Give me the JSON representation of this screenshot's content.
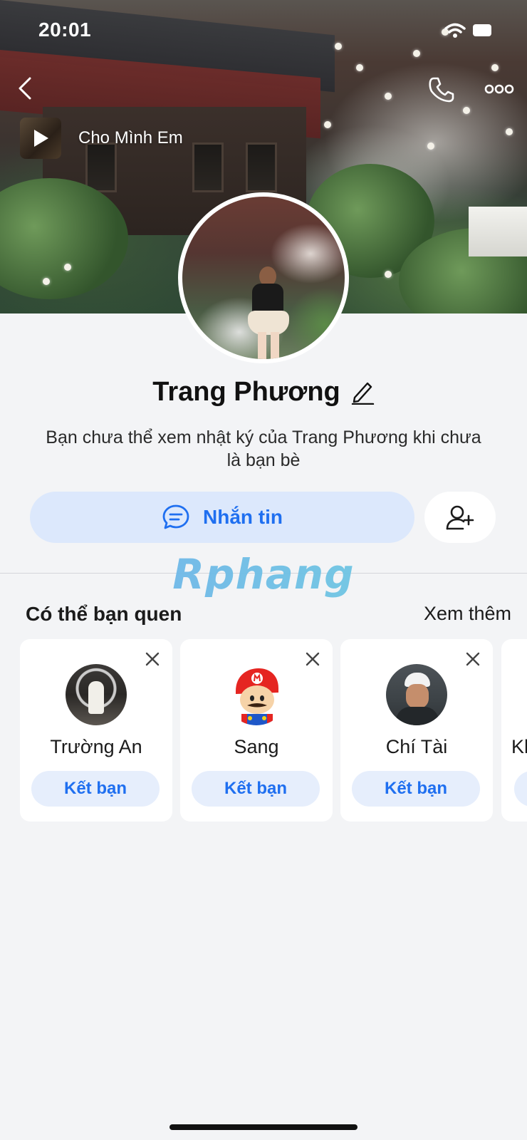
{
  "status_bar": {
    "time": "20:01",
    "wifi_icon": "wifi-icon",
    "battery_icon": "battery-icon"
  },
  "top_bar": {
    "back_icon": "chevron-left-icon",
    "call_icon": "phone-icon",
    "more_icon": "more-horizontal-icon"
  },
  "music": {
    "title": "Cho Mình Em",
    "icon": "play-icon"
  },
  "profile": {
    "name": "Trang Phương",
    "edit_icon": "pencil-icon",
    "notice": "Bạn chưa thể xem nhật ký của Trang Phương khi chưa là bạn bè"
  },
  "actions": {
    "message_label": "Nhắn tin",
    "message_icon": "chat-bubble-icon",
    "add_friend_icon": "user-plus-icon"
  },
  "watermark": "Rphang",
  "suggestions": {
    "title": "Có thể bạn quen",
    "see_more": "Xem thêm",
    "items": [
      {
        "name": "Trường An",
        "button": "Kết bạn"
      },
      {
        "name": "Sang",
        "button": "Kết bạn"
      },
      {
        "name": "Chí Tài",
        "button": "Kết bạn"
      },
      {
        "name": "Kh"
      }
    ]
  },
  "colors": {
    "accent": "#1f6ff0",
    "accent_light": "#dce8fc",
    "background": "#f3f4f6"
  }
}
